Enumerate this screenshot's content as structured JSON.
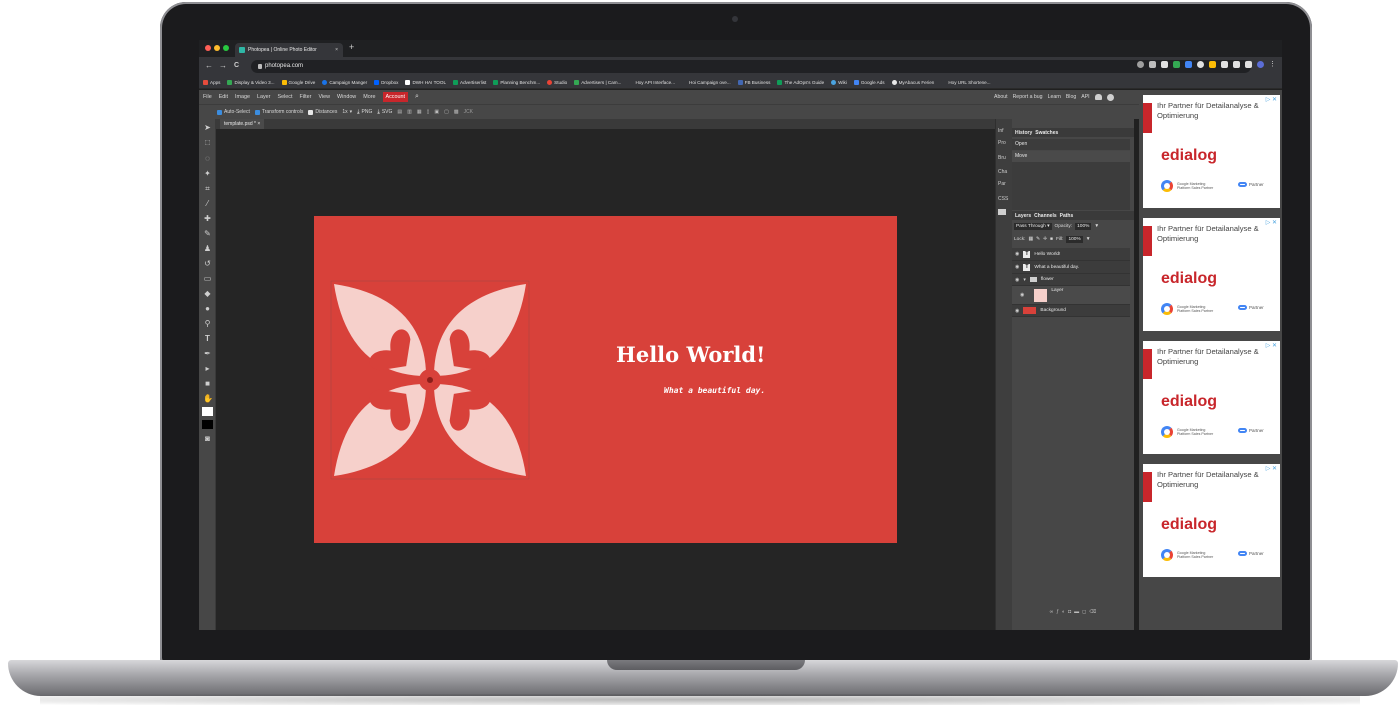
{
  "browser": {
    "tab_title": "Photopea | Online Photo Editor",
    "tab_close": "×",
    "new_tab": "+",
    "url": "photopea.com",
    "nav": {
      "back": "←",
      "forward": "→",
      "reload": "C"
    }
  },
  "bookmarks": [
    {
      "label": "Apps",
      "color": "#e74c3c"
    },
    {
      "label": "Display & Video 3...",
      "color": "#34a853"
    },
    {
      "label": "Google Drive",
      "color": "#fbbc05"
    },
    {
      "label": "Campaign Manger",
      "color": "#1a73e8"
    },
    {
      "label": "Dropbox",
      "color": "#0061ff"
    },
    {
      "label": "DWH HAI TOOL",
      "color": "#ffffff"
    },
    {
      "label": "Advertiserlist",
      "color": "#0f9d58"
    },
    {
      "label": "Planning Benchm...",
      "color": "#0f9d58"
    },
    {
      "label": "Studio",
      "color": "#ea4335"
    },
    {
      "label": "Advertisers | Cam...",
      "color": "#34a853"
    },
    {
      "label": "Hoy API Interface...",
      "color": "#35363a"
    },
    {
      "label": "Hoi Campaign ove...",
      "color": "#35363a"
    },
    {
      "label": "FB Business",
      "color": "#4267b2"
    },
    {
      "label": "The AdOps's Guide",
      "color": "#0f9d58"
    },
    {
      "label": "Wiki",
      "color": "#4aa3df"
    },
    {
      "label": "Google Ads",
      "color": "#4285f4"
    },
    {
      "label": "MyAbacus Ferien",
      "color": "#e8e8e8"
    },
    {
      "label": "Hoy URL Shortene...",
      "color": "#35363a"
    }
  ],
  "menu": {
    "items": [
      "File",
      "Edit",
      "Image",
      "Layer",
      "Select",
      "Filter",
      "View",
      "Window",
      "More"
    ],
    "account": "Account",
    "right": [
      "About",
      "Report a bug",
      "Learn",
      "Blog",
      "API"
    ]
  },
  "options": {
    "auto_select": "Auto-Select",
    "transform_controls": "Transform controls",
    "distances": "Distances",
    "scale": "1x",
    "png": "PNG",
    "svg": "SVG",
    "extra": "JCK"
  },
  "document": {
    "tab": "template.psd *",
    "close": "×"
  },
  "canvas": {
    "title": "Hello World!",
    "subtitle": "What a beautiful day."
  },
  "mini_panels": [
    "Inf",
    "Pro",
    "Bru",
    "Cha",
    "Par",
    "CSS"
  ],
  "history": {
    "tabs": [
      "History",
      "Swatches"
    ],
    "items": [
      "Open",
      "Move"
    ]
  },
  "layers": {
    "tabs": [
      "Layers",
      "Channels",
      "Paths"
    ],
    "blend_mode": "Pass Through",
    "opacity_label": "Opacity:",
    "opacity": "100%",
    "lock_label": "Lock:",
    "fill_label": "Fill:",
    "fill": "100%",
    "items": [
      "Hello World!",
      "What a beautiful day.",
      "flower",
      "Layer",
      "Background"
    ]
  },
  "ads": {
    "text": "Ihr Partner für Detailanalyse & Optimierung",
    "logo": "edialog",
    "footer": "Google Marketing Platform Sales Partner",
    "partner": "Partner",
    "close": "▷ ✕"
  },
  "colors": {
    "canvas_bg": "#d8413a",
    "flower": "#f6d0cb",
    "accent": "#c8262b"
  }
}
